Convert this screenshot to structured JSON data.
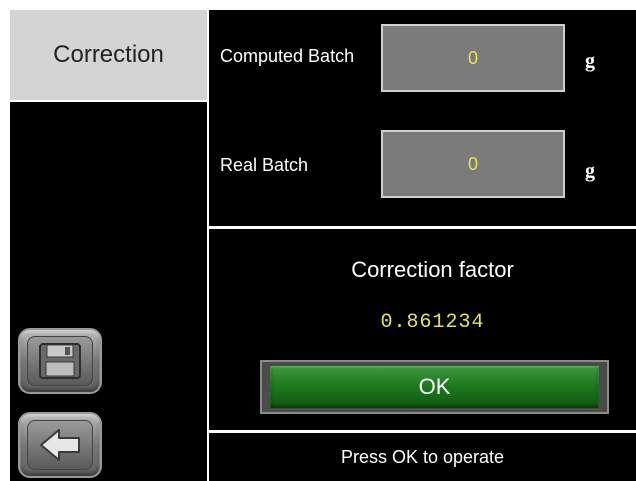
{
  "sidebar": {
    "tab_label": "Correction",
    "buttons": [
      {
        "name": "save",
        "icon": "floppy-disk-icon"
      },
      {
        "name": "back",
        "icon": "arrow-left-icon"
      }
    ]
  },
  "fields": {
    "computed_batch": {
      "label": "Computed Batch",
      "value": "0",
      "unit": "g"
    },
    "real_batch": {
      "label": "Real Batch",
      "value": "0",
      "unit": "g"
    }
  },
  "correction": {
    "label": "Correction factor",
    "value": "0.861234"
  },
  "ok_label": "OK",
  "status": "Press OK to operate",
  "colors": {
    "background": "#000000",
    "tab_bg": "#d4d4d4",
    "field_bg": "#7b7b7b",
    "value_text": "#e9e34a",
    "ok_green": "#1f7a1f"
  }
}
